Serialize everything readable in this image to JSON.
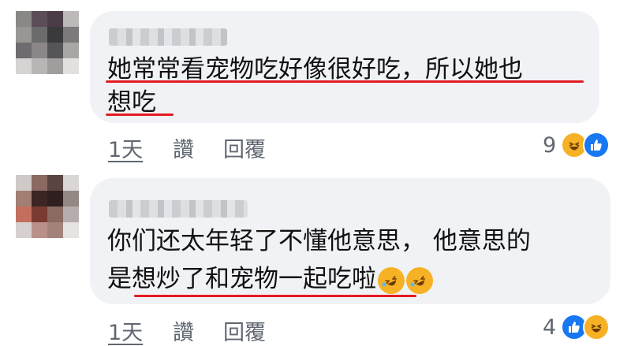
{
  "comments": [
    {
      "line1": "她常常看宠物吃好像很好吃，所以她也",
      "line2": "想吃",
      "time": "1天",
      "like": "讚",
      "reply": "回覆",
      "reaction_count": "9",
      "reaction_icons": [
        "laughing-face-icon",
        "thumbs-up-icon"
      ]
    },
    {
      "line1": "你们还太年轻了不懂他意思， 他意思的",
      "line2": "是想炒了和宠物一起吃啦",
      "time": "1天",
      "like": "讚",
      "reply": "回覆",
      "reaction_count": "4",
      "reaction_icons": [
        "thumbs-up-icon",
        "laughing-face-icon"
      ],
      "inline_emojis": [
        "rolling-on-floor-laughing-icon",
        "rolling-on-floor-laughing-icon"
      ]
    }
  ],
  "colors": {
    "bubble": "#f0f2f5",
    "underline": "#e41b23",
    "like_blue": "#1877f2",
    "haha_yellow": "#f7b125"
  }
}
